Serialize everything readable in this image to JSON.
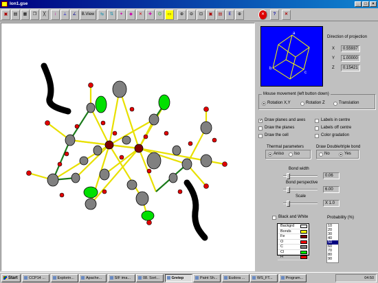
{
  "window": {
    "title": "lon1.gse",
    "min": "_",
    "max": "□",
    "close": "×"
  },
  "toolbar": {
    "view_label": "B.View",
    "buttons": [
      "open",
      "print",
      "print-preview",
      "copy",
      "draw-bonds",
      "move-atoms",
      "axes",
      "view",
      "rotate-x",
      "rotate-y",
      "select",
      "colour",
      "delete-atom",
      "add-atom",
      "bond",
      "grow",
      "zoom-in",
      "zoom-out",
      "fit",
      "render",
      "edit",
      "add",
      "stop",
      "help",
      "exit"
    ]
  },
  "projection": {
    "title": "Direction of projection",
    "x_label": "X",
    "x_value": "0.55937",
    "y_label": "Y",
    "y_value": "1.00000",
    "z_label": "Z",
    "z_value": "0.15421",
    "cell_a": "a",
    "cell_b": "b",
    "cell_c": "c"
  },
  "mouse": {
    "title": "Mouse movement (left button down)",
    "options": [
      "Rotation X,Y",
      "Rotation Z",
      "Translation"
    ],
    "selected": 0
  },
  "checks": {
    "planes_axes": "Draw planes and axes",
    "draw_planes": "Draw the planes",
    "draw_cell": "Draw the cell",
    "labels_centre": "Labels in centre",
    "labels_off": "Labels off centre",
    "color_grad": "Color gradation"
  },
  "thermal": {
    "title": "Thermal parameters",
    "aniso": "Aniso",
    "iso": "Iso"
  },
  "bond_type": {
    "title": "Draw Double/triple bond",
    "no": "No",
    "yes": "Yes"
  },
  "bond_width": {
    "label": "Bond width",
    "value": "0.06",
    "level": 0.1
  },
  "perspective": {
    "label": "Bond perspective",
    "value": "6.00",
    "level": 0.1
  },
  "scale": {
    "label": "Scale",
    "value": "X 1.0",
    "level": 0.1
  },
  "bw": {
    "label": "Black and White"
  },
  "probability": {
    "label": "Probability (%)",
    "options": [
      "10",
      "20",
      "30",
      "40",
      "50",
      "60",
      "70",
      "80",
      "90"
    ],
    "selected": "50"
  },
  "legend": {
    "rows": [
      {
        "label": "Backgrd",
        "color": "#ffffff"
      },
      {
        "label": "Bonds",
        "color": "#ffff00"
      },
      {
        "label": "Fe",
        "color": "#800000"
      },
      {
        "label": "O",
        "color": "#ff0000"
      },
      {
        "label": "C",
        "color": "#808080"
      },
      {
        "label": "Cl",
        "color": "#00ff00"
      },
      {
        "label": "H",
        "color": "#ff0000"
      }
    ]
  },
  "taskbar": {
    "start": "Start",
    "items": [
      "CCP14 ...",
      "Explorin...",
      "Apache...",
      "SIF ima...",
      "08. Sort...",
      "Gretep",
      "Paint Sh...",
      "Eudora ...",
      "WS_FT...",
      "Program..."
    ],
    "active": "Gretep",
    "time": "04:50"
  }
}
